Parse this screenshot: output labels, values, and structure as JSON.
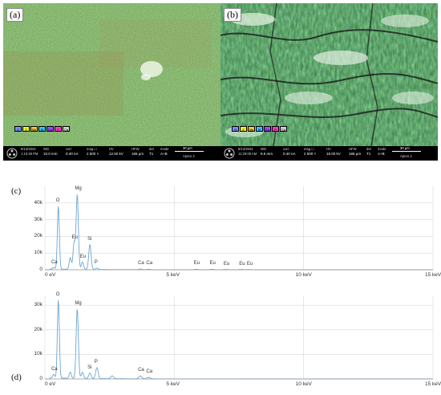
{
  "panel_a": {
    "label": "(a)",
    "legend_items": [
      "O",
      "Z",
      "Mg",
      "Si",
      "Eu",
      "P",
      "Ca"
    ],
    "legend_colors": [
      "#7a8cff",
      "#f0f020",
      "#f5c542",
      "#39c0ff",
      "#a24cff",
      "#ff3cc8",
      "#cfcfcf"
    ],
    "info": {
      "date": "8/13/2024",
      "time": "1:15:28 PM",
      "wd_label": "WD",
      "wd": "10.0 mm",
      "curr_label": "curr",
      "curr": "0.40 nA",
      "mag_label": "mag ☐",
      "mag": "2 500 ×",
      "hv_label": "HV",
      "hv": "12.50 kV",
      "hfw_label": "HFW",
      "hfw": "166 μm",
      "det_label": "det",
      "det": "T1",
      "mode_label": "mode",
      "mode": "A+B",
      "scale": "30 μm",
      "operator": "Apreo 2"
    }
  },
  "panel_b": {
    "label": "(b)",
    "legend_items": [
      "O",
      "Z",
      "Mg",
      "Si",
      "Eu",
      "P",
      "Ca"
    ],
    "legend_colors": [
      "#7a8cff",
      "#f0f020",
      "#f5c542",
      "#39c0ff",
      "#a24cff",
      "#ff3cc8",
      "#cfcfcf"
    ],
    "info": {
      "date": "8/14/2024",
      "time": "11:29:09 AM",
      "wd_label": "WD",
      "wd": "9.6 mm",
      "curr_label": "curr",
      "curr": "0.40 nA",
      "mag_label": "mag ☐",
      "mag": "2 500 ×",
      "hv_label": "HV",
      "hv": "15.00 kV",
      "hfw_label": "HFW",
      "hfw": "166 μm",
      "det_label": "det",
      "det": "T1",
      "mode_label": "mode",
      "mode": "A+B",
      "scale": "30 μm",
      "operator": "Apreo 2"
    }
  },
  "chart_data": [
    {
      "type": "line",
      "label": "(c)",
      "x_tick_labels": [
        "0 eV",
        "5 keV",
        "10 keV",
        "15 keV"
      ],
      "x_ticks": [
        0,
        5,
        10,
        15
      ],
      "y_tick_labels": [
        "0",
        "10k",
        "20k",
        "30k",
        "40k"
      ],
      "y_ticks": [
        0,
        10000,
        20000,
        30000,
        40000
      ],
      "xlim": [
        0,
        15
      ],
      "ylim": [
        0,
        50000
      ],
      "grid": true,
      "peaks": [
        {
          "x": 0.34,
          "y": 900
        },
        {
          "x": 0.52,
          "y": 38000
        },
        {
          "x": 0.98,
          "y": 7000
        },
        {
          "x": 1.13,
          "y": 16000
        },
        {
          "x": 1.25,
          "y": 45000
        },
        {
          "x": 1.45,
          "y": 4500
        },
        {
          "x": 1.74,
          "y": 15000
        },
        {
          "x": 2.01,
          "y": 900
        },
        {
          "x": 3.69,
          "y": 400
        },
        {
          "x": 4.01,
          "y": 300
        },
        {
          "x": 5.85,
          "y": 300
        },
        {
          "x": 6.46,
          "y": 250
        },
        {
          "x": 7.0,
          "y": 200
        },
        {
          "x": 7.6,
          "y": 180
        },
        {
          "x": 7.9,
          "y": 150
        }
      ],
      "annotations": [
        {
          "text": "Ca",
          "x": 0.34,
          "y": 900
        },
        {
          "text": "O",
          "x": 0.52,
          "y": 38000
        },
        {
          "text": "Eu",
          "x": 1.13,
          "y": 16000
        },
        {
          "text": "Mg",
          "x": 1.25,
          "y": 45000
        },
        {
          "text": "Eu",
          "x": 1.45,
          "y": 4500
        },
        {
          "text": "Si",
          "x": 1.74,
          "y": 15000
        },
        {
          "text": "P",
          "x": 2.01,
          "y": 900
        },
        {
          "text": "Ca",
          "x": 3.69,
          "y": 400
        },
        {
          "text": "Ca",
          "x": 4.01,
          "y": 300
        },
        {
          "text": "Eu",
          "x": 5.85,
          "y": 300
        },
        {
          "text": "Eu",
          "x": 6.46,
          "y": 250
        },
        {
          "text": "Eu",
          "x": 7.0,
          "y": 200
        },
        {
          "text": "Eu",
          "x": 7.6,
          "y": 180
        },
        {
          "text": "Eu",
          "x": 7.9,
          "y": 150
        }
      ]
    },
    {
      "type": "line",
      "label": "(d)",
      "x_tick_labels": [
        "0 eV",
        "5 keV",
        "10 keV",
        "15 keV"
      ],
      "x_ticks": [
        0,
        5,
        10,
        15
      ],
      "y_tick_labels": [
        "0",
        "10k",
        "20k",
        "30k"
      ],
      "y_ticks": [
        0,
        10000,
        20000,
        30000
      ],
      "xlim": [
        0,
        15
      ],
      "ylim": [
        0,
        34000
      ],
      "grid": true,
      "peaks": [
        {
          "x": 0.34,
          "y": 1500
        },
        {
          "x": 0.52,
          "y": 32000
        },
        {
          "x": 0.98,
          "y": 2500
        },
        {
          "x": 1.25,
          "y": 28500
        },
        {
          "x": 1.45,
          "y": 2500
        },
        {
          "x": 1.74,
          "y": 2200
        },
        {
          "x": 2.01,
          "y": 4500
        },
        {
          "x": 2.6,
          "y": 1200
        },
        {
          "x": 3.69,
          "y": 1200
        },
        {
          "x": 4.01,
          "y": 600
        }
      ],
      "annotations": [
        {
          "text": "Ca",
          "x": 0.34,
          "y": 1500
        },
        {
          "text": "O",
          "x": 0.52,
          "y": 32000
        },
        {
          "text": "Mg",
          "x": 1.25,
          "y": 28500
        },
        {
          "text": "Si",
          "x": 1.74,
          "y": 2200
        },
        {
          "text": "P",
          "x": 2.01,
          "y": 4500
        },
        {
          "text": "Ca",
          "x": 3.69,
          "y": 1200
        },
        {
          "text": "Ca",
          "x": 4.01,
          "y": 600
        }
      ]
    }
  ]
}
